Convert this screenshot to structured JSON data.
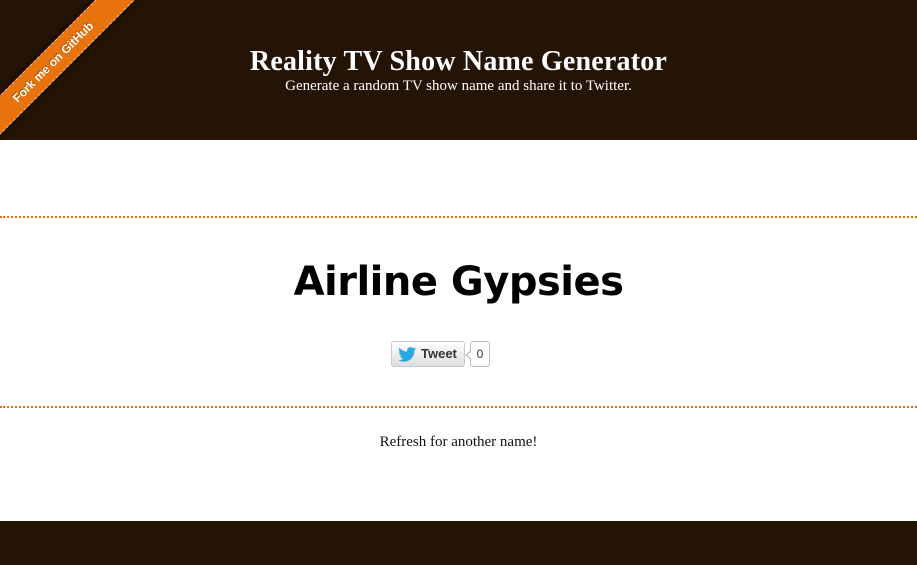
{
  "header": {
    "title": "Reality TV Show Name Generator",
    "subtitle": "Generate a random TV show name and share it to Twitter.",
    "background_color": "#231406"
  },
  "ribbon": {
    "label": "Fork me on GitHub",
    "color": "#e8720c"
  },
  "main": {
    "show_name": "Airline Gypsies",
    "separator_color": "#e8720c"
  },
  "tweet": {
    "label": "Tweet",
    "count": "0",
    "icon": "twitter-bird-icon"
  },
  "refresh_note": "Refresh for another name!",
  "footer": {
    "background_color": "#231406"
  }
}
